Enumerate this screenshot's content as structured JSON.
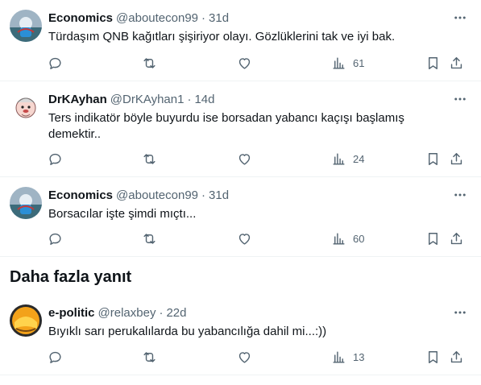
{
  "tweets": [
    {
      "name": "Economics",
      "handle": "@aboutecon99",
      "dot": "·",
      "time": "31d",
      "text": "Türdaşım QNB kağıtları şişiriyor olayı. Gözlüklerini tak ve iyi bak.",
      "views": "61",
      "avatar": "economics-avatar"
    },
    {
      "name": "DrKAyhan",
      "handle": "@DrKAyhan1",
      "dot": "·",
      "time": "14d",
      "text": "Ters indikatör böyle buyurdu ise borsadan yabancı kaçışı başlamış demektir..",
      "views": "24",
      "avatar": "cartoon-avatar"
    },
    {
      "name": "Economics",
      "handle": "@aboutecon99",
      "dot": "·",
      "time": "31d",
      "text": "Borsacılar işte şimdi mıçtı...",
      "views": "60",
      "avatar": "economics-avatar"
    },
    {
      "name": "e-politic",
      "handle": "@relaxbey",
      "dot": "·",
      "time": "22d",
      "text": "Bıyıklı sarı perukalılarda bu yabancılığa dahil mi...:))",
      "views": "13",
      "avatar": "e-politic-avatar"
    }
  ],
  "more_replies_label": "Daha fazla yanıt",
  "colors": {
    "text": "#0f1419",
    "muted": "#536471",
    "divider": "#eff3f4"
  }
}
